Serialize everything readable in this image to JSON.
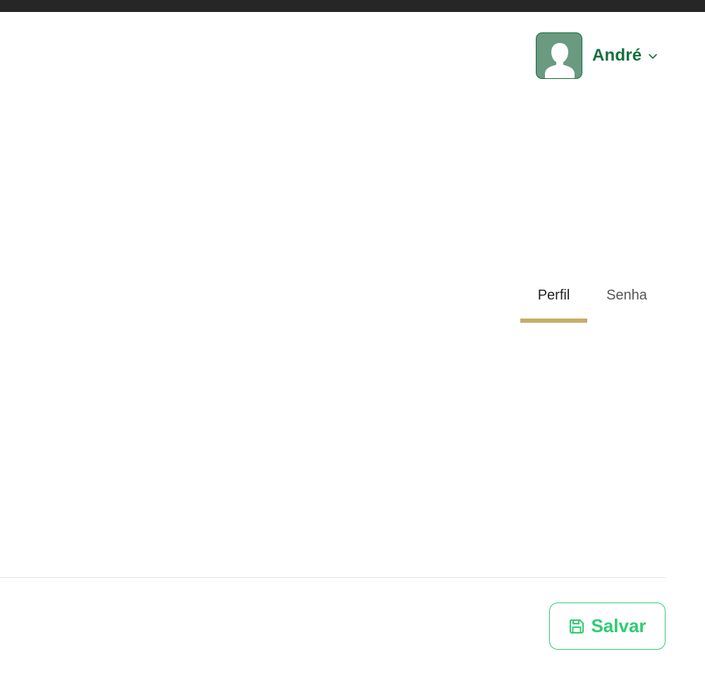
{
  "header": {
    "user": {
      "name": "André",
      "avatar_icon": "user-silhouette-icon",
      "menu_icon": "chevron-down-icon"
    }
  },
  "tabs": [
    {
      "label": "Perfil",
      "active": true
    },
    {
      "label": "Senha",
      "active": false
    }
  ],
  "footer": {
    "save_label": "Salvar",
    "save_icon": "floppy-disk-icon"
  },
  "colors": {
    "brand_green": "#15703f",
    "accent_gold": "#c8ad69",
    "save_green": "#2ecc71",
    "top_bar": "#262626"
  }
}
